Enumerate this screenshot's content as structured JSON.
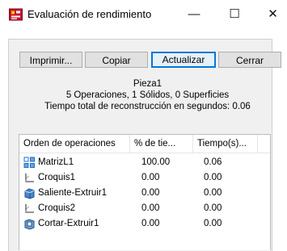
{
  "window": {
    "title": "Evaluación de rendimiento",
    "minimize_glyph": "—",
    "maximize_glyph": "☐",
    "close_glyph": "✕"
  },
  "buttons": {
    "print": "Imprimir...",
    "copy": "Copiar",
    "update": "Actualizar",
    "close": "Cerrar"
  },
  "summary": {
    "part_name": "Pieza1",
    "counts": "5 Operaciones, 1 Sólidos, 0 Superficies",
    "rebuild_time": "Tiempo total de reconstrucción en segundos: 0.06"
  },
  "list": {
    "columns": [
      "Orden de operaciones",
      "% de tie...",
      "Tiempo(s)..."
    ],
    "rows": [
      {
        "name": "MatrizL1",
        "icon": "linear-pattern-icon",
        "percent": "100.00",
        "time": "0.06"
      },
      {
        "name": "Croquis1",
        "icon": "sketch-icon",
        "percent": "0.00",
        "time": "0.00"
      },
      {
        "name": "Saliente-Extruir1",
        "icon": "boss-extrude-icon",
        "percent": "0.00",
        "time": "0.00"
      },
      {
        "name": "Croquis2",
        "icon": "sketch-icon",
        "percent": "0.00",
        "time": "0.00"
      },
      {
        "name": "Cortar-Extruir1",
        "icon": "cut-extrude-icon",
        "percent": "0.00",
        "time": "0.00"
      }
    ]
  }
}
